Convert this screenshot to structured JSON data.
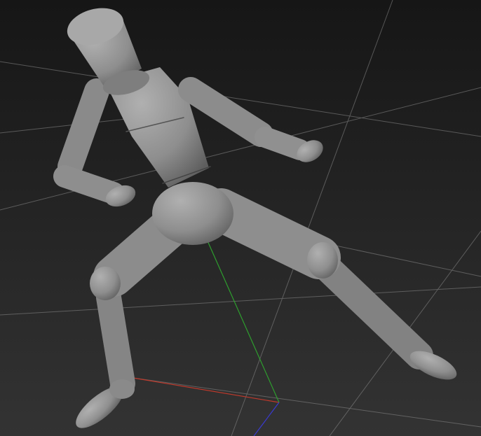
{
  "viewport": {
    "background_top": "#161616",
    "background_bottom": "#333333",
    "grid_color": "#8a8a8a",
    "axis_x_color": "#c0392b",
    "axis_y_color": "#2e9e2e",
    "axis_z_color": "#3a3acf",
    "model_color": "#8e8e8e",
    "model_shade": "#6a6a6a",
    "model_highlight": "#b4b4b4"
  }
}
